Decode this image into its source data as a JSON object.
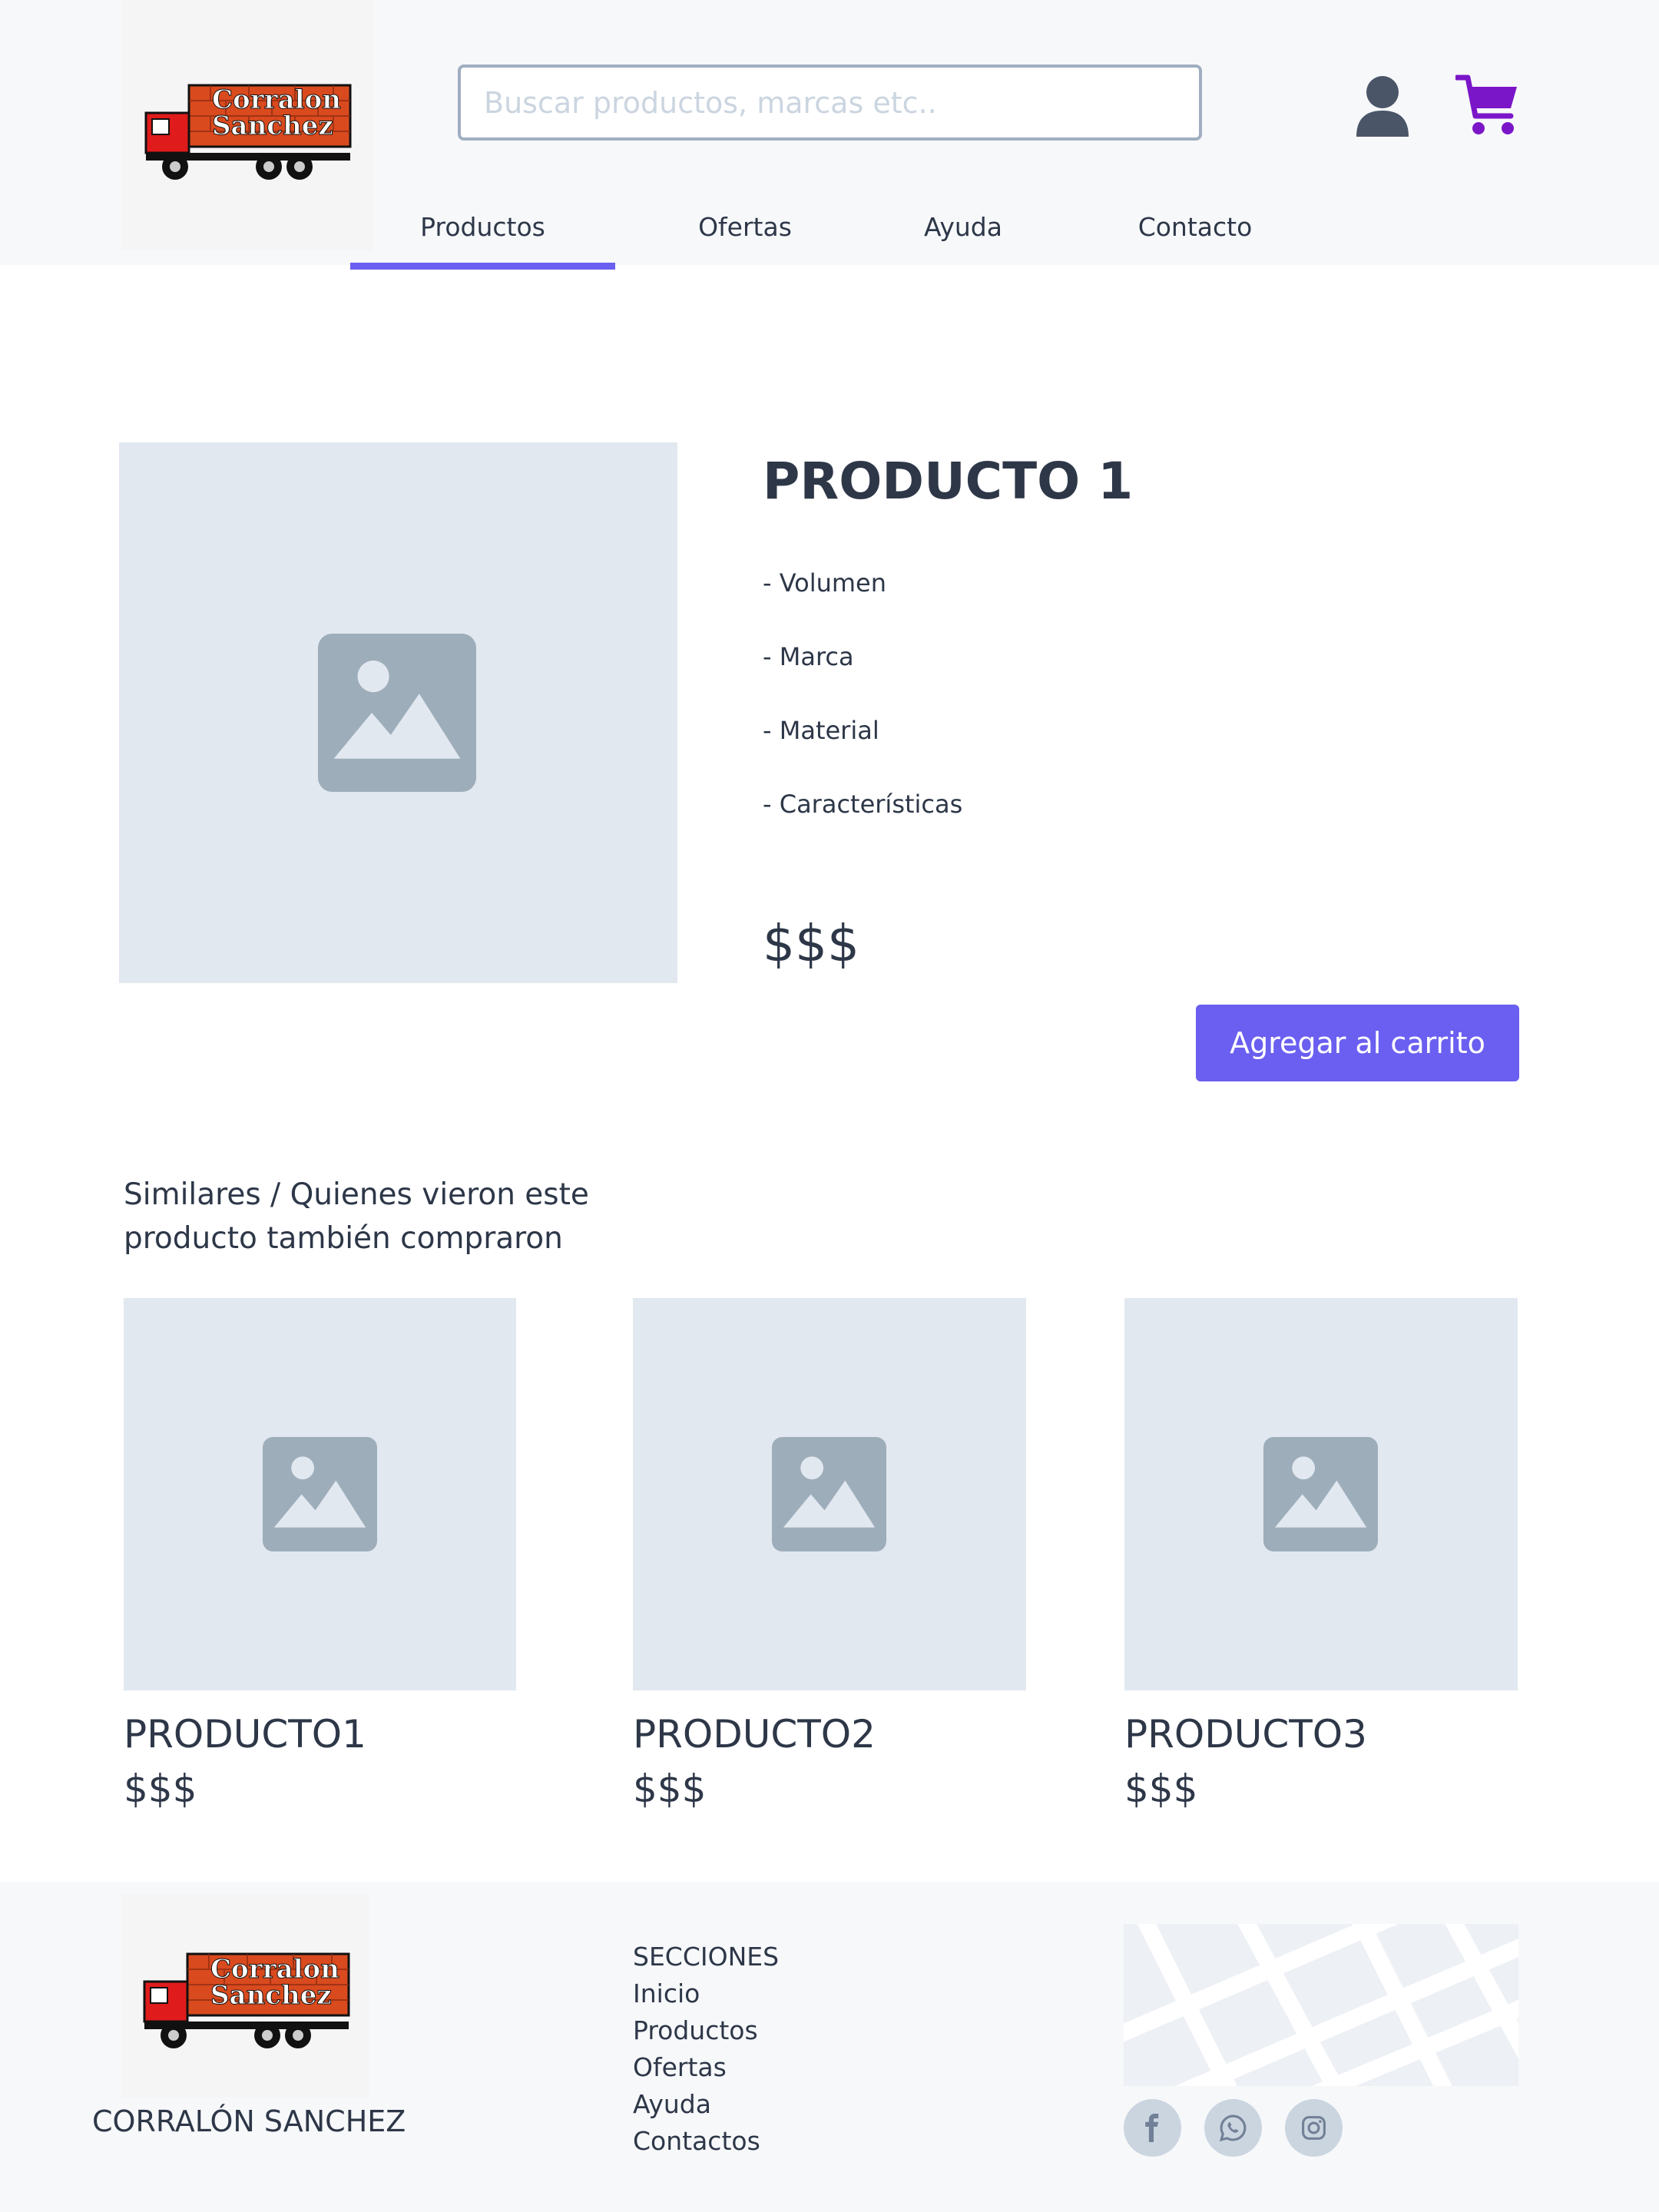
{
  "brand": {
    "logo_text_line1": "Corralon",
    "logo_text_line2": "Sanchez",
    "footer_name": "CORRALÓN SANCHEZ"
  },
  "header": {
    "search_placeholder": "Buscar productos, marcas etc..",
    "user_icon": "user-icon",
    "cart_icon": "cart-icon",
    "nav": [
      {
        "label": "Productos",
        "active": true
      },
      {
        "label": "Ofertas"
      },
      {
        "label": "Ayuda"
      },
      {
        "label": "Contacto"
      }
    ]
  },
  "product": {
    "title": "PRODUCTO 1",
    "features": [
      "- Volumen",
      "- Marca",
      "- Material",
      "- Características"
    ],
    "price": "$$$",
    "add_to_cart": "Agregar al carrito",
    "image_icon": "image-placeholder-icon"
  },
  "similar": {
    "title": "Similares / Quienes vieron este producto también compraron",
    "items": [
      {
        "name": "PRODUCTO1",
        "price": "$$$"
      },
      {
        "name": "PRODUCTO2",
        "price": "$$$"
      },
      {
        "name": "PRODUCTO3",
        "price": "$$$"
      }
    ]
  },
  "footer": {
    "sections_title": "SECCIONES",
    "links": [
      "Inicio",
      "Productos",
      "Ofertas",
      "Ayuda",
      "Contactos"
    ],
    "social": [
      "facebook-icon",
      "whatsapp-icon",
      "instagram-icon"
    ]
  },
  "colors": {
    "accent": "#6a5ff0",
    "cart": "#7b16c8",
    "placeholder_bg": "#e2e8f0",
    "placeholder_icon": "#9eadba"
  }
}
